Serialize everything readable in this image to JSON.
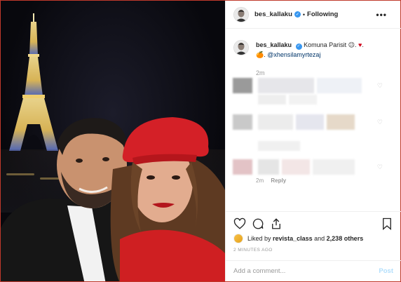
{
  "post": {
    "username": "bes_kallaku",
    "follow_separator": "•",
    "follow_status": "Following",
    "more_icon": "more-dots-icon",
    "caption": {
      "username": "bes_kallaku",
      "text": "Komuna Parisit",
      "emoji1": "😉",
      "emoji2": "♥",
      "emoji3": "🍊",
      "mention": "@xhensilamyrtezaj",
      "time": "2m"
    },
    "reply_label": "Reply",
    "reply_time": "2m",
    "likes": {
      "prefix": "Liked by",
      "user": "revista_class",
      "and": "and",
      "others": "2,238 others"
    },
    "time_ago": "2 MINUTES AGO",
    "comment": {
      "placeholder": "Add a comment...",
      "post_label": "Post"
    },
    "colors": {
      "verified": "#3897f0",
      "mention": "#003569",
      "muted": "#999999",
      "post_disabled": "#b2dffc"
    }
  }
}
